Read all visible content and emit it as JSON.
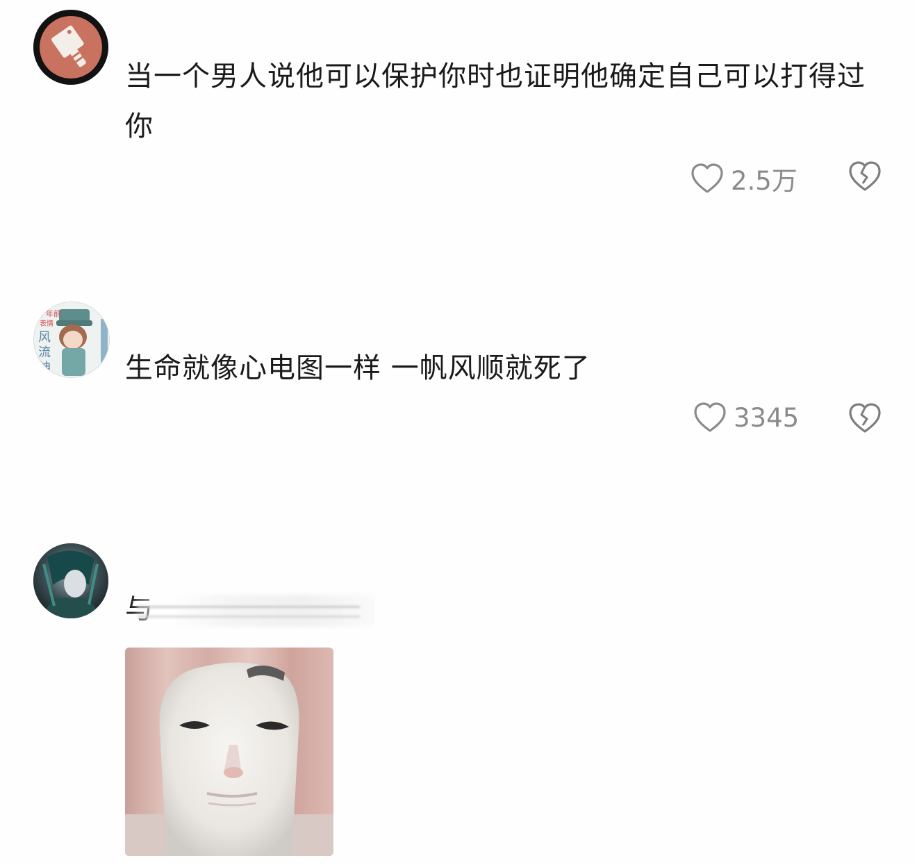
{
  "comments": [
    {
      "text": "当一个男人说他可以保护你时也证明他确定自己可以打得过你",
      "likes": "2.5万",
      "avatar_icon": "cleaver-icon"
    },
    {
      "text": "生命就像心电图一样 一帆风顺就死了",
      "likes": "3345",
      "avatar_icon": "anime-character-avatar",
      "avatar_badge": [
        "十年前",
        "表情",
        "风",
        "流",
        "神"
      ]
    },
    {
      "username_partial": "与",
      "username_obscured": true,
      "avatar_icon": "dark-character-avatar",
      "image": "meme-face-image"
    }
  ],
  "colors": {
    "background": "#fefefe",
    "text": "#1a1a1a",
    "meta": "#8a8a8a"
  }
}
